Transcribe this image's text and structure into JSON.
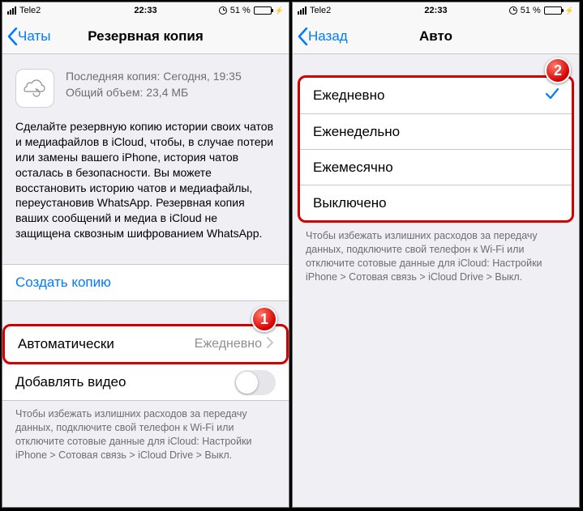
{
  "status": {
    "carrier": "Tele2",
    "time": "22:33",
    "battery_pct": "51 %"
  },
  "left": {
    "back_label": "Чаты",
    "title": "Резервная копия",
    "last_copy_label": "Последняя копия: Сегодня, 19:35",
    "size_label": "Общий объем: 23,4 МБ",
    "description": "Сделайте резервную копию истории своих чатов и медиафайлов в iCloud, чтобы, в случае потери или замены вашего iPhone, история чатов осталась в безопасности. Вы можете восстановить историю чатов и медиафайлы, переустановив WhatsApp. Резервная копия ваших сообщений и медиа в iCloud не защищена сквозным шифрованием WhatsApp.",
    "create_backup": "Создать копию",
    "auto_label": "Автоматически",
    "auto_value": "Ежедневно",
    "include_video": "Добавлять видео",
    "footnote": "Чтобы избежать излишних расходов за передачу данных, подключите свой телефон к Wi-Fi или отключите сотовые данные для iCloud: Настройки iPhone > Сотовая связь > iCloud Drive > Выкл.",
    "step": "1"
  },
  "right": {
    "back_label": "Назад",
    "title": "Авто",
    "options": {
      "daily": "Ежедневно",
      "weekly": "Еженедельно",
      "monthly": "Ежемесячно",
      "off": "Выключено"
    },
    "footnote": "Чтобы избежать излишних расходов за передачу данных, подключите свой телефон к Wi-Fi или отключите сотовые данные для iCloud: Настройки iPhone > Сотовая связь > iCloud Drive > Выкл.",
    "step": "2"
  }
}
